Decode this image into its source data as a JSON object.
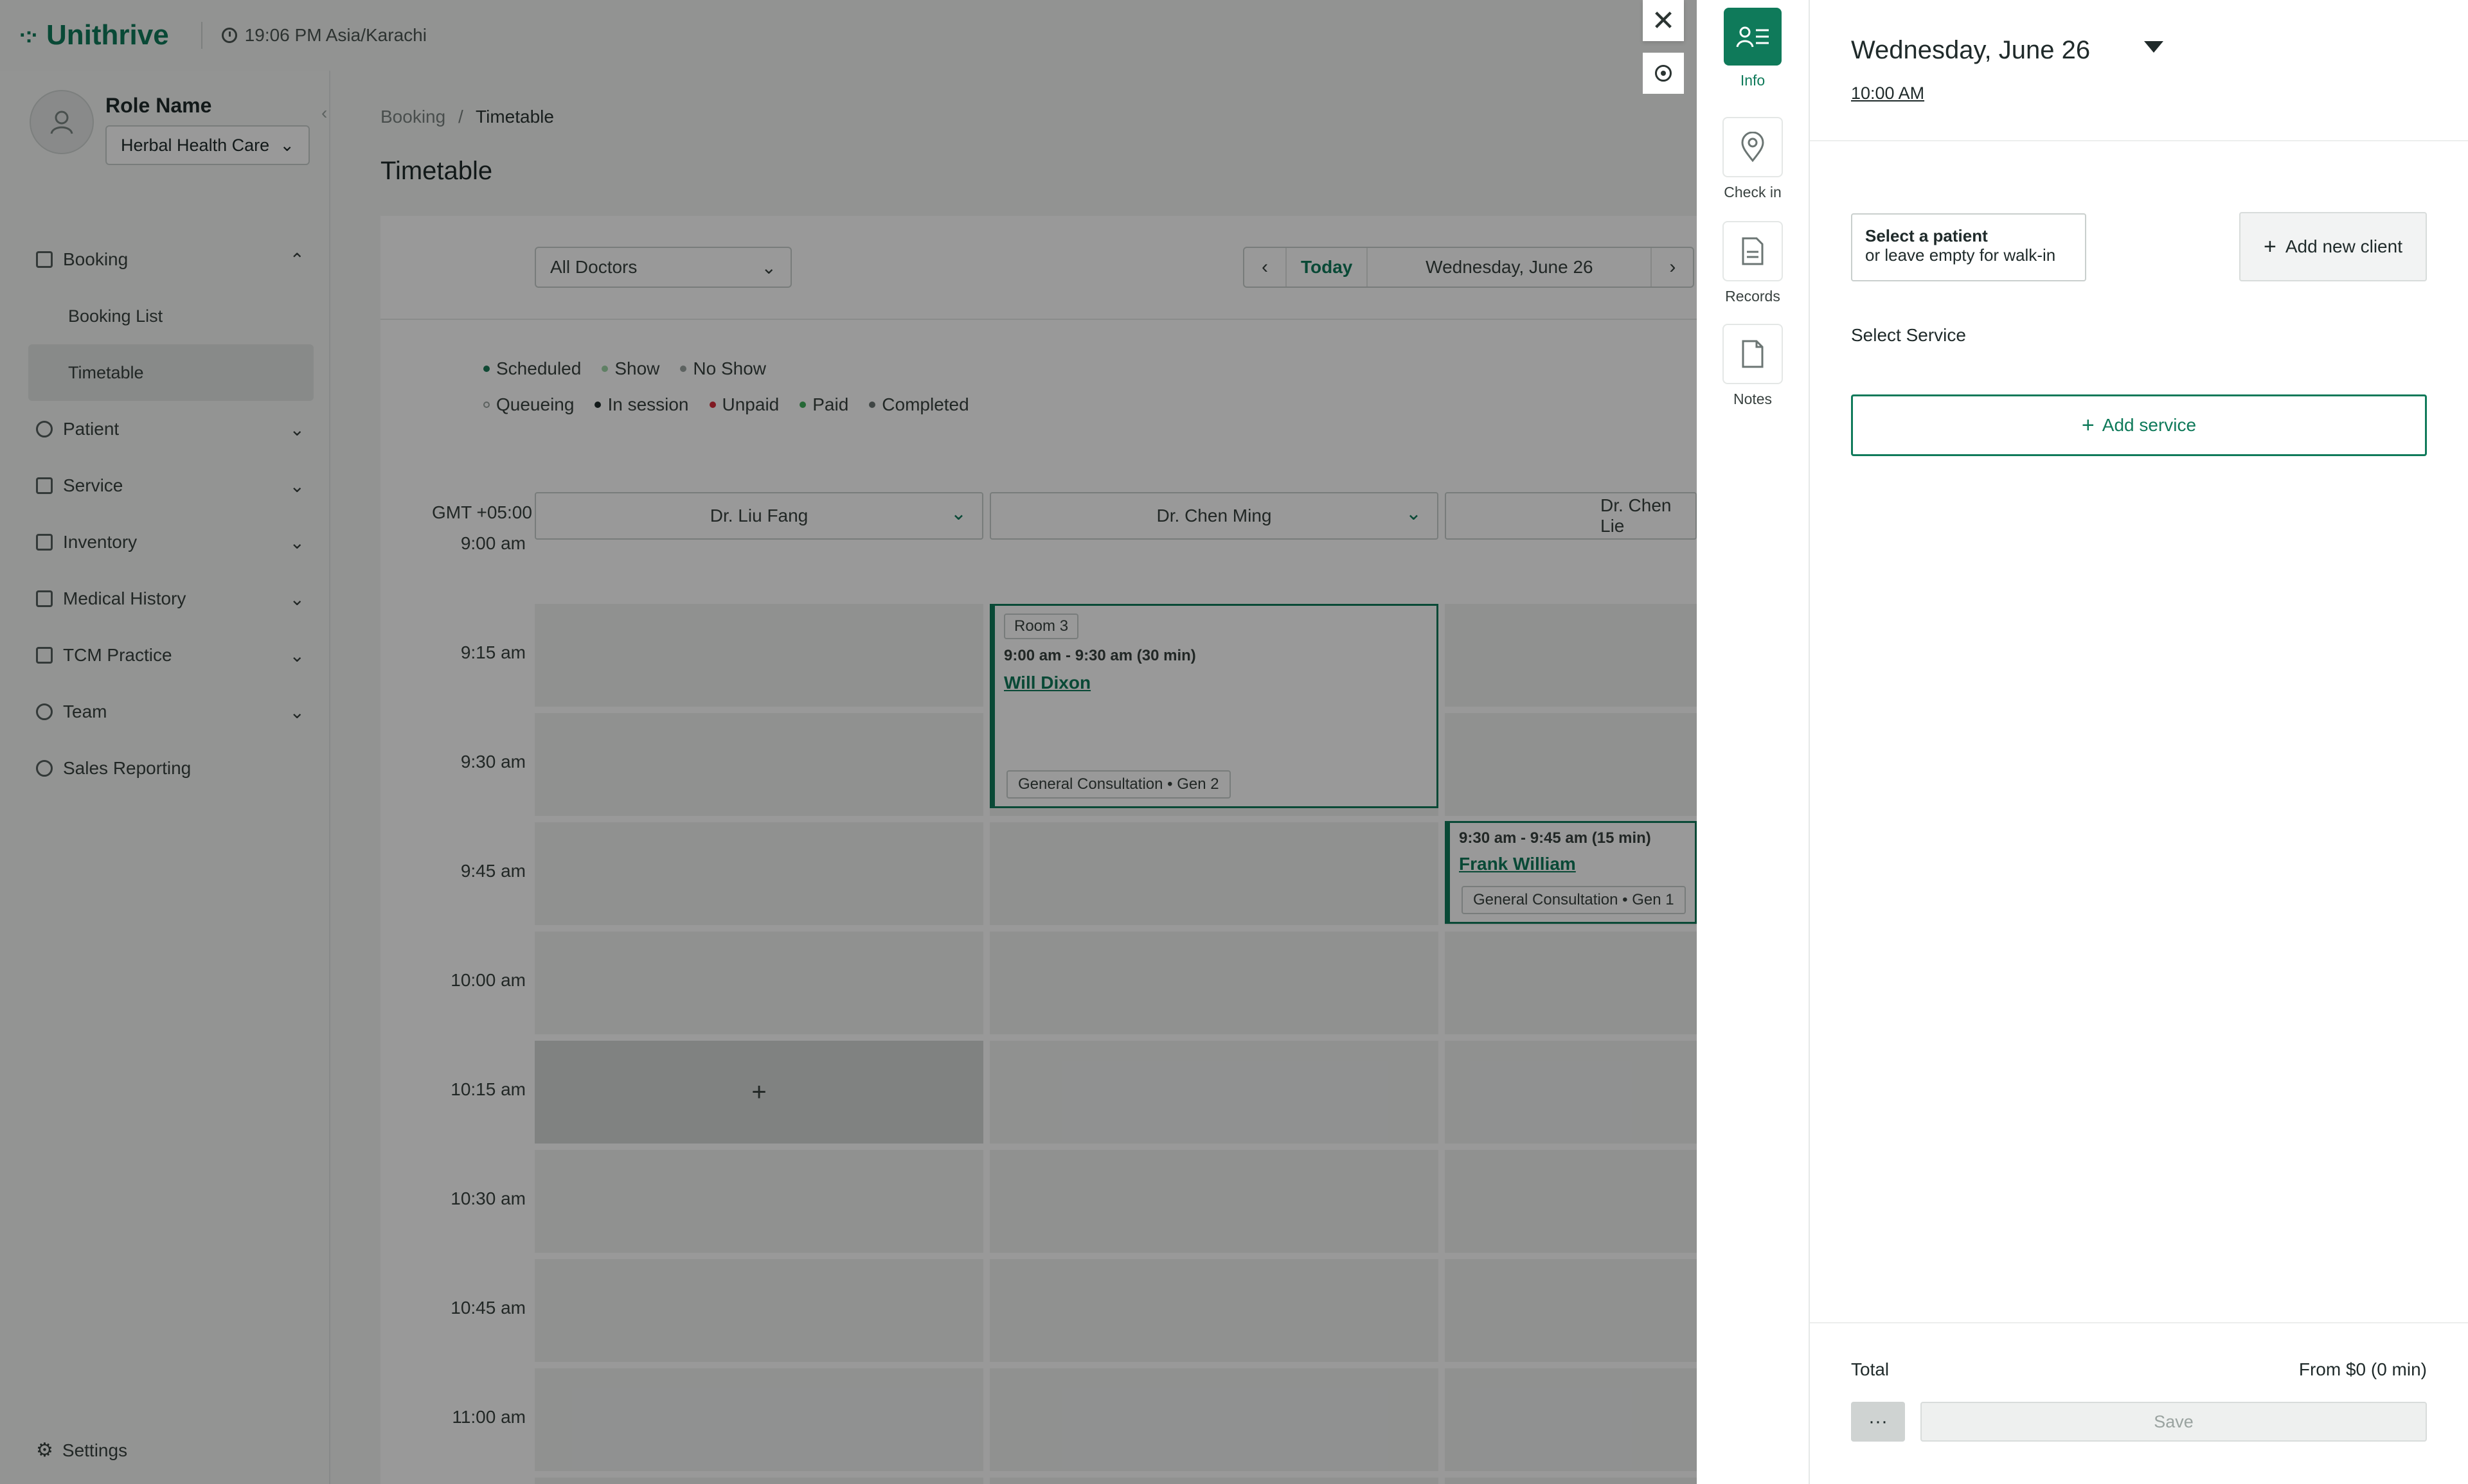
{
  "app": {
    "logo": "Unithrive",
    "time": "19:06 PM Asia/Karachi"
  },
  "sidebar": {
    "role_name": "Role Name",
    "organization": "Herbal Health Care",
    "nav": [
      {
        "label": "Booking",
        "expanded": true,
        "icon": "booking-icon"
      },
      {
        "label": "Booking List"
      },
      {
        "label": "Timetable",
        "active": true
      },
      {
        "label": "Patient",
        "icon": "patient-icon"
      },
      {
        "label": "Service",
        "icon": "service-icon"
      },
      {
        "label": "Inventory",
        "icon": "inventory-icon"
      },
      {
        "label": "Medical History",
        "icon": "medical-history-icon"
      },
      {
        "label": "TCM Practice",
        "icon": "tcm-icon"
      },
      {
        "label": "Team",
        "icon": "team-icon"
      },
      {
        "label": "Sales Reporting",
        "icon": "sales-icon"
      }
    ],
    "settings": "Settings"
  },
  "main": {
    "breadcrumb": {
      "root": "Booking",
      "sep": "/",
      "current": "Timetable"
    },
    "title": "Timetable",
    "doctor_filter": "All Doctors",
    "date_nav": {
      "today": "Today",
      "date": "Wednesday, June 26"
    },
    "legend": {
      "row1": [
        {
          "label": "Scheduled",
          "color": "#1b7a57"
        },
        {
          "label": "Show",
          "color": "#9fd6a7"
        },
        {
          "label": "No Show",
          "color": "#9aa3a0"
        }
      ],
      "row2": [
        {
          "label": "Queueing",
          "color": "#ffffff"
        },
        {
          "label": "In session",
          "color": "#1f2a2a"
        },
        {
          "label": "Unpaid",
          "color": "#d62b3a"
        },
        {
          "label": "Paid",
          "color": "#3fae5a"
        },
        {
          "label": "Completed",
          "color": "#6b7573"
        }
      ]
    },
    "timezone": "GMT +05:00",
    "doctors": [
      "Dr. Liu Fang",
      "Dr. Chen Ming",
      "Dr. Chen Lie"
    ],
    "times": [
      "9:00 am",
      "9:15 am",
      "9:30 am",
      "9:45 am",
      "10:00 am",
      "10:15 am",
      "10:30 am",
      "10:45 am",
      "11:00 am"
    ],
    "appointments": [
      {
        "room": "Room 3",
        "time": "9:00 am - 9:30 am (30 min)",
        "patient": "Will Dixon",
        "service": "General Consultation  •  Gen 2"
      },
      {
        "time": "9:30 am - 9:45 am (15 min)",
        "patient": "Frank William",
        "service": "General Consultation  •  Gen 1"
      }
    ],
    "add_slot": "+"
  },
  "drawer": {
    "rail": [
      {
        "label": "Info",
        "icon": "info-icon",
        "active": true
      },
      {
        "label": "Check in",
        "icon": "location-pin-icon"
      },
      {
        "label": "Records",
        "icon": "document-icon"
      },
      {
        "label": "Notes",
        "icon": "notes-icon"
      }
    ],
    "date": "Wednesday, June 26",
    "time": "10:00 AM",
    "patient_select": {
      "title": "Select a patient",
      "hint": "or leave empty for walk-in"
    },
    "add_client": "Add new client",
    "select_service": "Select Service",
    "add_service": "Add service",
    "total_label": "Total",
    "total_value": "From $0 (0 min)",
    "more": "···",
    "save": "Save"
  }
}
